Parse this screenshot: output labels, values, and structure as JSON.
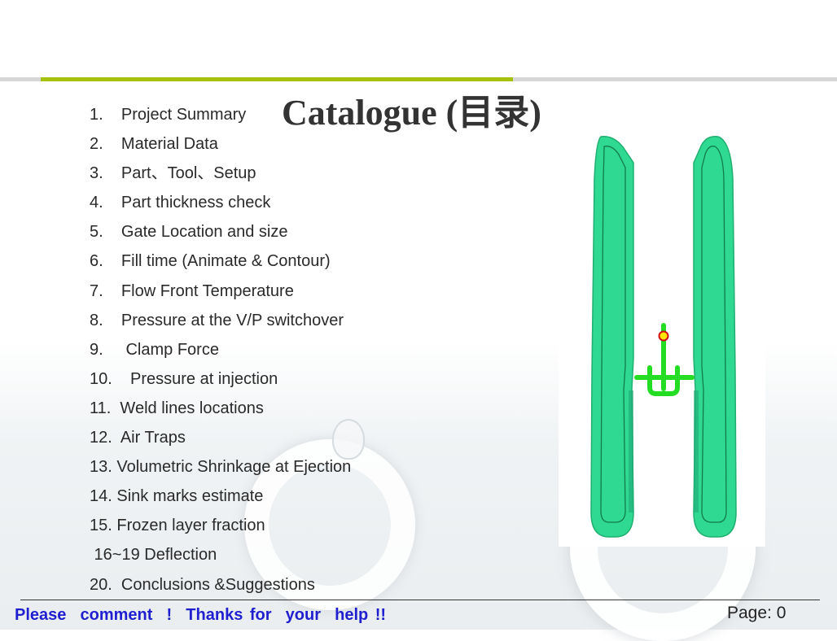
{
  "slide": {
    "title": "Catalogue  (目录)",
    "items": [
      "1.    Project Summary",
      "2.    Material Data",
      "3.    Part、Tool、Setup",
      "4.    Part thickness check",
      "5.    Gate Location and size",
      "6.    Fill time (Animate & Contour)",
      "7.    Flow Front Temperature",
      "8.    Pressure at the V/P switchover",
      "9.     Clamp Force",
      "10.    Pressure at injection",
      "11.  Weld lines locations",
      "12.  Air Traps",
      "13. Volumetric Shrinkage at Ejection",
      "14. Sink marks estimate",
      "15. Frozen layer fraction",
      " 16~19 Deflection",
      "20.  Conclusions &Suggestions"
    ],
    "footer": {
      "comment": "Please  comment  !  Thanks for  your  help !!",
      "page": "Page: 0"
    }
  },
  "colors": {
    "accent_green": "#a6c10a",
    "footer_blue": "#1f1fd0",
    "part_green": "#2fd991",
    "runner_green": "#22dd22"
  },
  "icons": {
    "injection_point": "injection-point-icon"
  }
}
